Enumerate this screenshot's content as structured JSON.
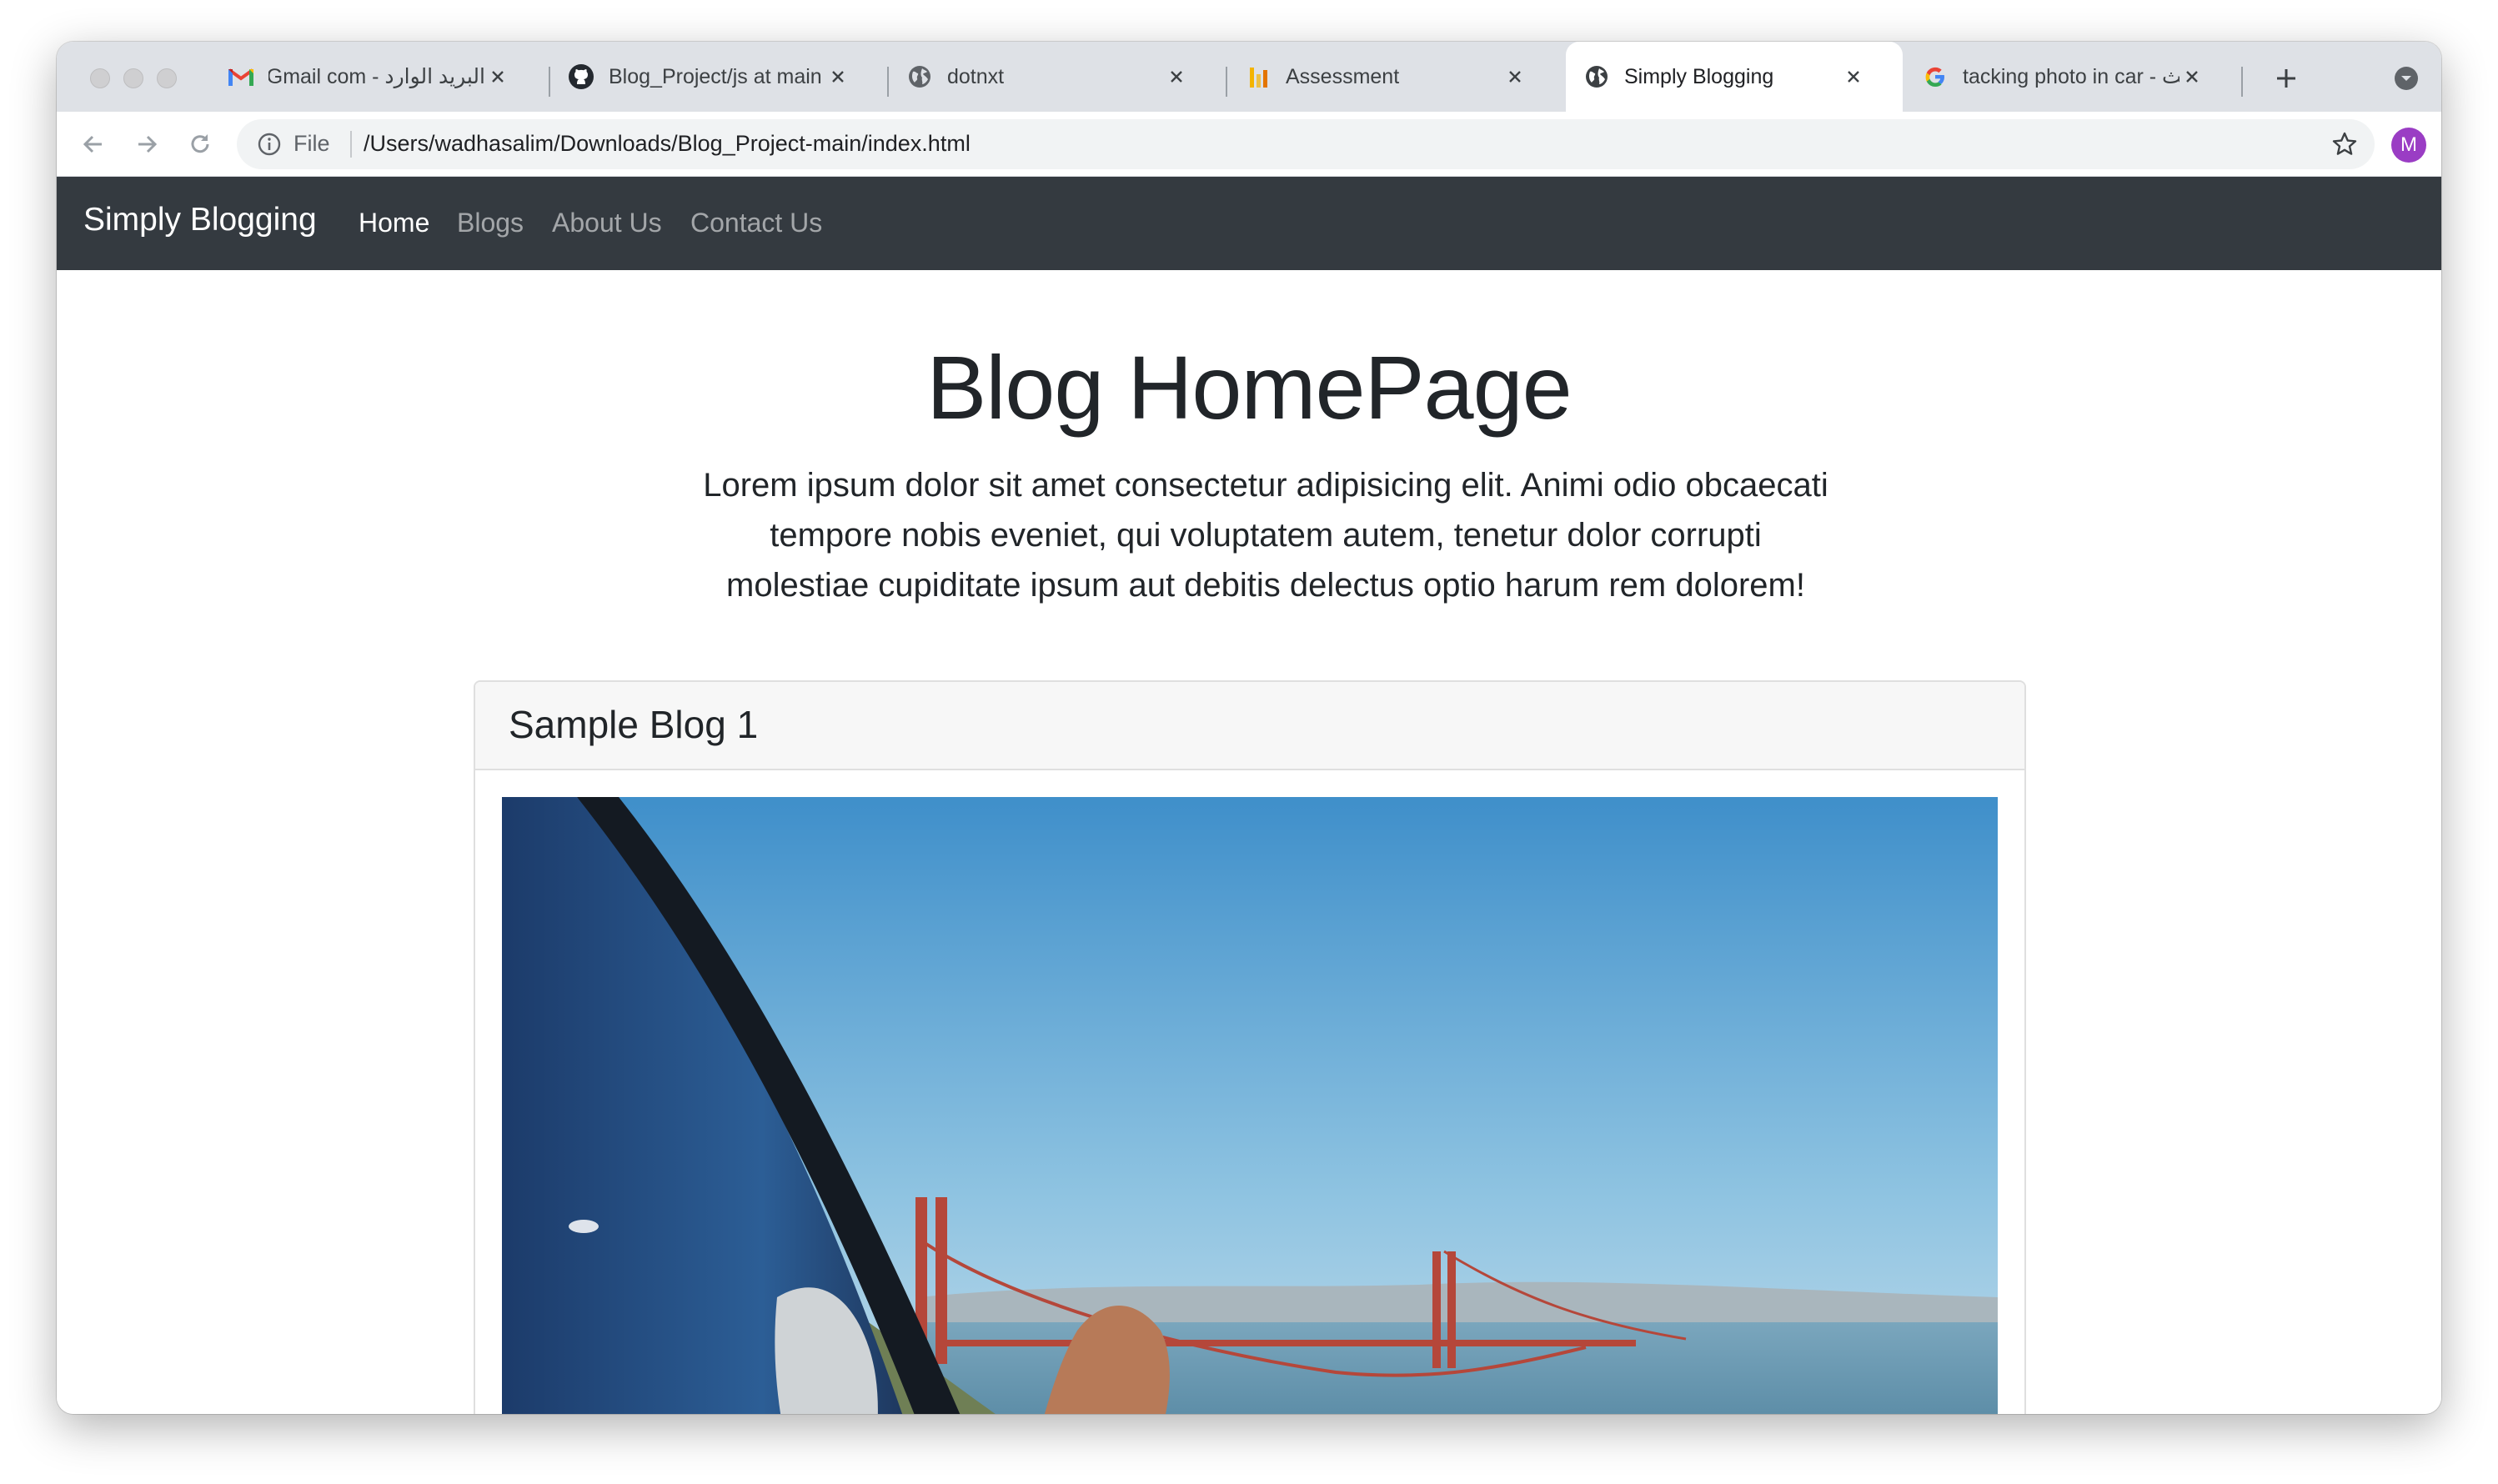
{
  "browser": {
    "tabs": [
      {
        "title": "البريد الوارد - Gmail com.",
        "favicon": "gmail-icon"
      },
      {
        "title": "Blog_Project/js at main · w",
        "favicon": "github-icon"
      },
      {
        "title": "dotnxt",
        "favicon": "globe-icon"
      },
      {
        "title": "Assessment",
        "favicon": "bar-chart-icon"
      },
      {
        "title": "Simply Blogging",
        "favicon": "globe-icon",
        "active": true
      },
      {
        "title": "tacking photo in car - بحث",
        "favicon": "google-icon"
      }
    ],
    "new_tab_icon": "plus-icon",
    "tab_search_icon": "chevron-down-circle-icon",
    "address": {
      "scheme_label": "File",
      "url": "/Users/wadhasalim/Downloads/Blog_Project-main/index.html"
    },
    "profile_initial": "M",
    "colors": {
      "avatar": "#9a3dc4",
      "tabstrip": "#dee1e6"
    }
  },
  "site": {
    "brand": "Simply Blogging",
    "nav": [
      "Home",
      "Blogs",
      "About Us",
      "Contact Us"
    ],
    "active_nav": "Home",
    "navbar_color": "#343a40"
  },
  "hero": {
    "title": "Blog HomePage",
    "lead": "Lorem ipsum dolor sit amet consectetur adipisicing elit. Animi odio obcaecati tempore nobis eveniet, qui voluptatem autem, tenetur dolor corrupti molestiae cupiditate ipsum aut debitis delectus optio harum rem dolorem!"
  },
  "cards": [
    {
      "title": "Sample Blog 1",
      "image": "golden-gate-bridge-from-car-window"
    }
  ]
}
